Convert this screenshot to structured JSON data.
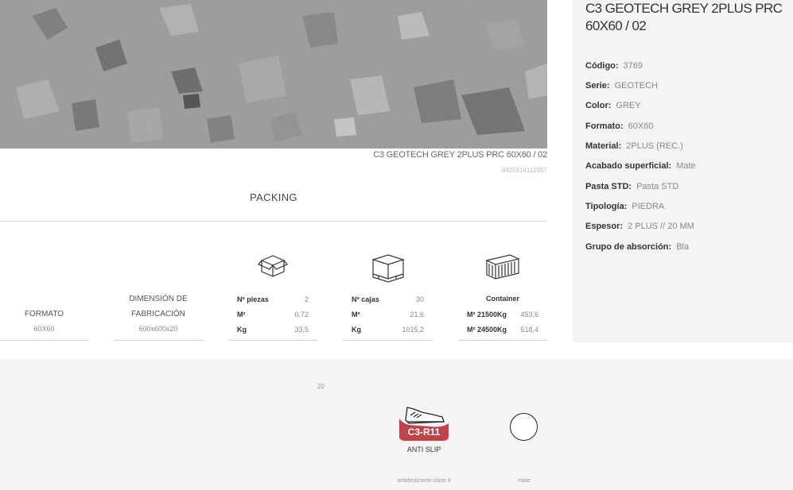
{
  "product": {
    "name": "C3 GEOTECH GREY 2PLUS PRC 60X60 / 02",
    "caption": "C3 GEOTECH GREY 2PLUS PRC 60X60 / 02",
    "ean": "8435414112957"
  },
  "packing": {
    "title": "PACKING",
    "formato": {
      "label": "FORMATO",
      "value": "60X60"
    },
    "dimension": {
      "label_line1": "DIMENSIÓN DE",
      "label_line2": "FABRICACIÓN",
      "value": "600x600x20"
    },
    "box": {
      "icon": "box-icon",
      "rows": [
        {
          "key": "Nº piezas",
          "value": "2"
        },
        {
          "key": "M²",
          "value": "0,72"
        },
        {
          "key": "Kg",
          "value": "33,5"
        }
      ]
    },
    "pallet": {
      "icon": "pallet-icon",
      "rows": [
        {
          "key": "Nº cajas",
          "value": "30"
        },
        {
          "key": "M²",
          "value": "21,6"
        },
        {
          "key": "Kg",
          "value": "1015,2"
        }
      ]
    },
    "container": {
      "icon": "container-icon",
      "title": "Container",
      "rows": [
        {
          "key": "M² 21500Kg",
          "value": "453,6"
        },
        {
          "key": "M² 24500Kg",
          "value": "518,4"
        }
      ]
    }
  },
  "specs": [
    {
      "key": "Código:",
      "value": "3769"
    },
    {
      "key": "Serie:",
      "value": "GEOTECH"
    },
    {
      "key": "Color:",
      "value": "GREY"
    },
    {
      "key": "Formato:",
      "value": "60X60"
    },
    {
      "key": "Material:",
      "value": "2PLUS (REC.)"
    },
    {
      "key": "Acabado superficial:",
      "value": "Mate"
    },
    {
      "key": "Pasta STD:",
      "value": "Pasta STD"
    },
    {
      "key": "Tipología:",
      "value": "PIEDRA"
    },
    {
      "key": "Espesor:",
      "value": "2 PLUS // 20 MM"
    },
    {
      "key": "Grupo de absorción:",
      "value": "Bla"
    }
  ],
  "features": {
    "small_number": "20",
    "anti_slip": {
      "badge": "C3-R11",
      "label": "ANTI SLIP",
      "description": "antideslizante clase 3",
      "icon": "shoe-icon"
    },
    "finish": {
      "description": "mate",
      "icon": "circle-icon"
    }
  },
  "colors": {
    "badge_red": "#c0434b",
    "panel_bg": "#f4f4f4"
  }
}
